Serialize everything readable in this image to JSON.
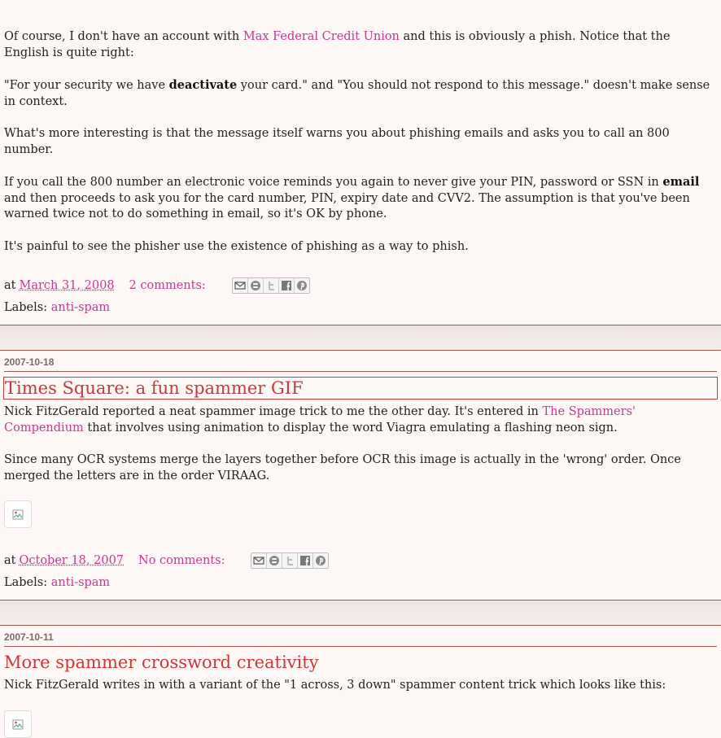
{
  "post1": {
    "p1_pre": "Of course, I don't have an account with ",
    "p1_link": "Max Federal Credit Union",
    "p1_post": " and this is obviously a phish. Notice that the English is quite right:",
    "p2_pre": "\"For your security we have ",
    "p2_bold": "deactivate",
    "p2_post": " your card.\" and \"You should not respond to this message.\" doesn't make sense in context.",
    "p3": "What's more interesting is that the message itself warns you about phishing emails and asks you to call an 800 number.",
    "p4_pre": "If you call the 800 number an electronic voice reminds you again to never give your PIN, password or SSN in ",
    "p4_bold": "email",
    "p4_post": " and then proceeds to ask you for the card number, PIN, expiry date and CVV2. The assumption is that you've been warned twice not to do something in email, so it's OK by phone.",
    "p5": "It's painful to see the phisher use the existence of phishing as a way to phish.",
    "at": "at",
    "timestamp": "March 31, 2008",
    "comments": "2 comments:",
    "labels_prefix": "Labels:",
    "label": "anti-spam"
  },
  "post2": {
    "date": "2007-10-18",
    "title": "Times Square: a fun spammer GIF",
    "p1_pre": "Nick FitzGerald reported a neat spammer image trick to me the other day. It's entered in ",
    "p1_link": "The Spammers' Compendium",
    "p1_post": " that involves using animation to display the word Viagra emulating a flashing neon sign.",
    "p2": "Since many OCR systems merge the layers together before OCR this image is actually in the 'wrong' order. Once merged the letters are in the order VIRAAG.",
    "at": "at",
    "timestamp": "October 18, 2007",
    "comments": "No comments:",
    "labels_prefix": "Labels:",
    "label": "anti-spam"
  },
  "post3": {
    "date": "2007-10-11",
    "title": "More spammer crossword creativity",
    "p1": "Nick FitzGerald writes in with a variant of the \"1 across, 3 down\" spammer content trick which looks like this:"
  },
  "colors": {
    "link": "#c23a96",
    "title": "#c8393a",
    "rule": "#aa5555",
    "background": "#fbf5f3"
  },
  "icons": [
    "email-icon",
    "blogger-icon",
    "twitter-icon",
    "facebook-icon",
    "pinterest-icon",
    "broken-image-icon"
  ]
}
